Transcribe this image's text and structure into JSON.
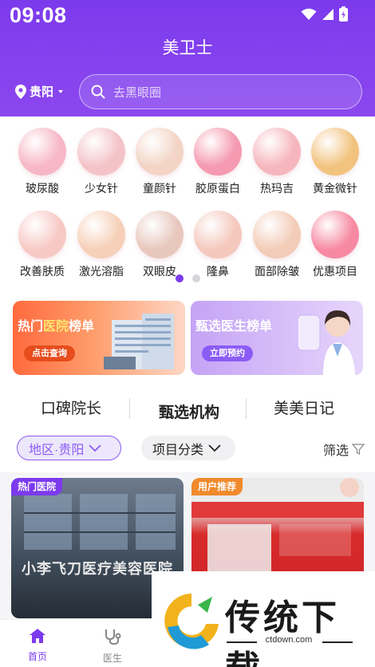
{
  "status_bar": {
    "time": "09:08"
  },
  "header": {
    "title": "美卫士",
    "city": "贵阳",
    "search_placeholder": "去黑眼圈"
  },
  "categories": [
    {
      "label": "玻尿酸",
      "icon": "hyaluronic-syringe-icon",
      "color": "#f7b7c7"
    },
    {
      "label": "少女针",
      "icon": "injection-gun-icon",
      "color": "#f4c3c8"
    },
    {
      "label": "童颜针",
      "icon": "youthful-face-icon",
      "color": "#f3d4c5"
    },
    {
      "label": "胶原蛋白",
      "icon": "collagen-bubbles-icon",
      "color": "#f59ab0"
    },
    {
      "label": "热玛吉",
      "icon": "thermage-device-icon",
      "color": "#f6b6bd"
    },
    {
      "label": "黄金微针",
      "icon": "gold-microneedle-icon",
      "color": "#f2c37e"
    },
    {
      "label": "改善肤质",
      "icon": "skin-care-face-icon",
      "color": "#f7c9c4"
    },
    {
      "label": "激光溶脂",
      "icon": "laser-lipo-device-icon",
      "color": "#f6d0b8"
    },
    {
      "label": "双眼皮",
      "icon": "eye-icon",
      "color": "#e8c7bc"
    },
    {
      "label": "隆鼻",
      "icon": "nose-icon",
      "color": "#f4c8bd"
    },
    {
      "label": "面部除皱",
      "icon": "wrinkle-removal-face-icon",
      "color": "#f3ccb8"
    },
    {
      "label": "优惠项目",
      "icon": "heart-gift-icon",
      "color": "#f78aa2"
    }
  ],
  "pager": {
    "total": 2,
    "active": 0
  },
  "banners": [
    {
      "title": "热门医院榜单",
      "title_highlight": "医院",
      "button": "点击查询"
    },
    {
      "title": "甄选医生榜单",
      "button": "立即预约"
    }
  ],
  "tabs": [
    {
      "label": "口碑院长",
      "active": false
    },
    {
      "label": "甄选机构",
      "active": true
    },
    {
      "label": "美美日记",
      "active": false
    }
  ],
  "filters": {
    "region": "地区·贵阳",
    "project": "项目分类",
    "filter_label": "筛选"
  },
  "cards": [
    {
      "tag": "热门医院",
      "sign": "小李飞刀医疗美容医院",
      "tag_color": "#7c3aed"
    },
    {
      "tag": "用户推荐",
      "sign": "",
      "tag_color": "#f08a2c"
    }
  ],
  "bottom_nav": [
    {
      "label": "首页",
      "icon": "home-icon",
      "active": true
    },
    {
      "label": "医生",
      "icon": "stethoscope-icon",
      "active": false
    }
  ],
  "watermark": {
    "title": "传统下载",
    "url": "ctdown.com"
  },
  "colors": {
    "brand": "#7c3aed",
    "banner_orange": "#ff6a3d",
    "banner_purple": "#c5a3f6"
  }
}
